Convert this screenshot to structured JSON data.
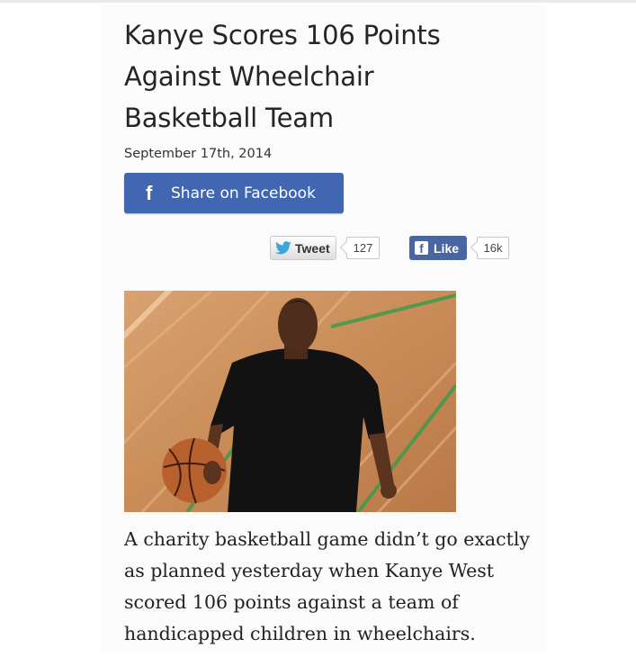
{
  "article": {
    "title": "Kanye Scores 106 Points Against Wheelchair Basketball Team",
    "date": "September 17th, 2014",
    "caption": "A charity basketball game didn’t go exactly as planned yesterday when Kanye West scored 106 points against a team of handicapped children in wheelchairs."
  },
  "share": {
    "facebook_icon": "f",
    "facebook_label": "Share on Facebook",
    "tweet_label": "Tweet",
    "tweet_count": "127",
    "like_icon": "f",
    "like_label": "Like",
    "like_count": "16k"
  },
  "colors": {
    "facebook_blue": "#4267b2",
    "like_blue": "#4a66a0",
    "twitter_blue": "#3da6e0"
  },
  "icons": {
    "share_icon": "facebook-f-icon",
    "tweet_icon": "twitter-bird-icon",
    "like_icon": "facebook-square-icon"
  }
}
